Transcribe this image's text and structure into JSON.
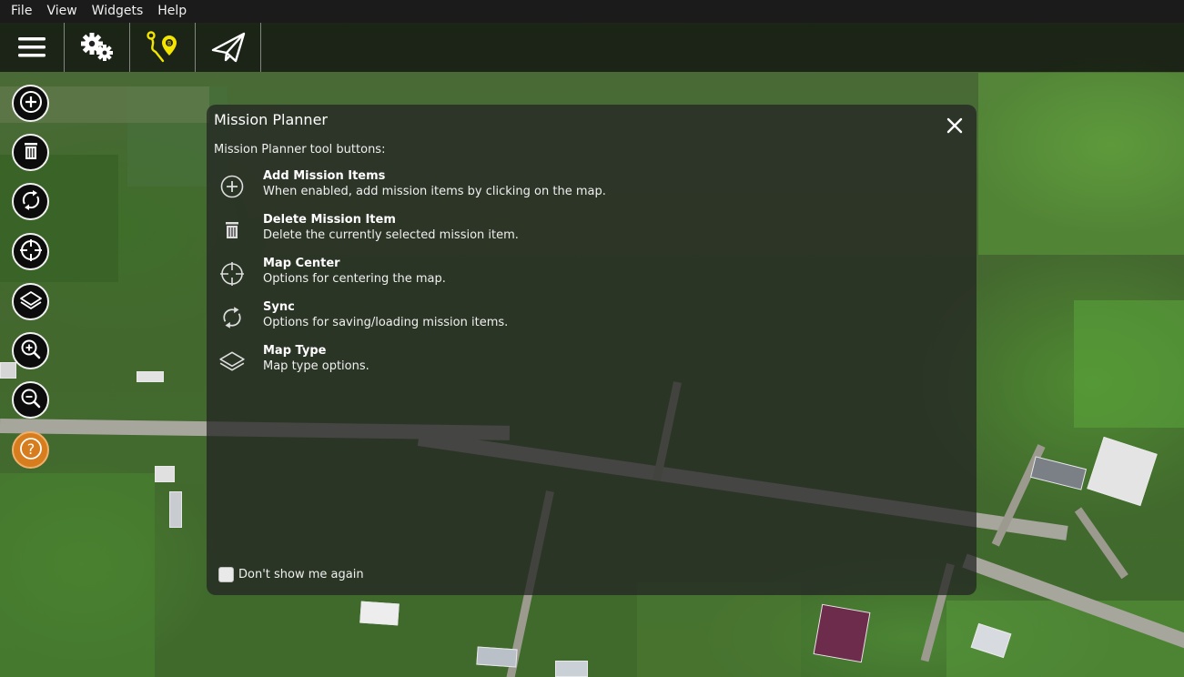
{
  "menubar": {
    "items": [
      "File",
      "View",
      "Widgets",
      "Help"
    ]
  },
  "toolbar": {
    "buttons": [
      {
        "name": "hamburger-menu-icon"
      },
      {
        "name": "gear-icon"
      },
      {
        "name": "waypoint-route-icon",
        "accent": "#f3e500"
      },
      {
        "name": "paper-plane-icon"
      }
    ]
  },
  "side_tools": [
    {
      "name": "add-icon"
    },
    {
      "name": "trash-icon"
    },
    {
      "name": "sync-icon"
    },
    {
      "name": "crosshair-icon"
    },
    {
      "name": "layers-icon"
    },
    {
      "name": "zoom-in-icon"
    },
    {
      "name": "zoom-out-icon"
    },
    {
      "name": "help-icon",
      "color": "#d77d1e"
    }
  ],
  "dialog": {
    "title": "Mission Planner",
    "subtitle": "Mission Planner tool buttons:",
    "items": [
      {
        "icon": "add-icon",
        "title": "Add Mission Items",
        "desc": "When enabled, add mission items by clicking on the map."
      },
      {
        "icon": "trash-icon",
        "title": "Delete Mission Item",
        "desc": "Delete the currently selected mission item."
      },
      {
        "icon": "crosshair-icon",
        "title": "Map Center",
        "desc": "Options for centering the map."
      },
      {
        "icon": "sync-icon",
        "title": "Sync",
        "desc": "Options for saving/loading mission items."
      },
      {
        "icon": "layers-icon",
        "title": "Map Type",
        "desc": "Map type options."
      }
    ],
    "dont_show_label": "Don't show me again",
    "dont_show_checked": false
  }
}
